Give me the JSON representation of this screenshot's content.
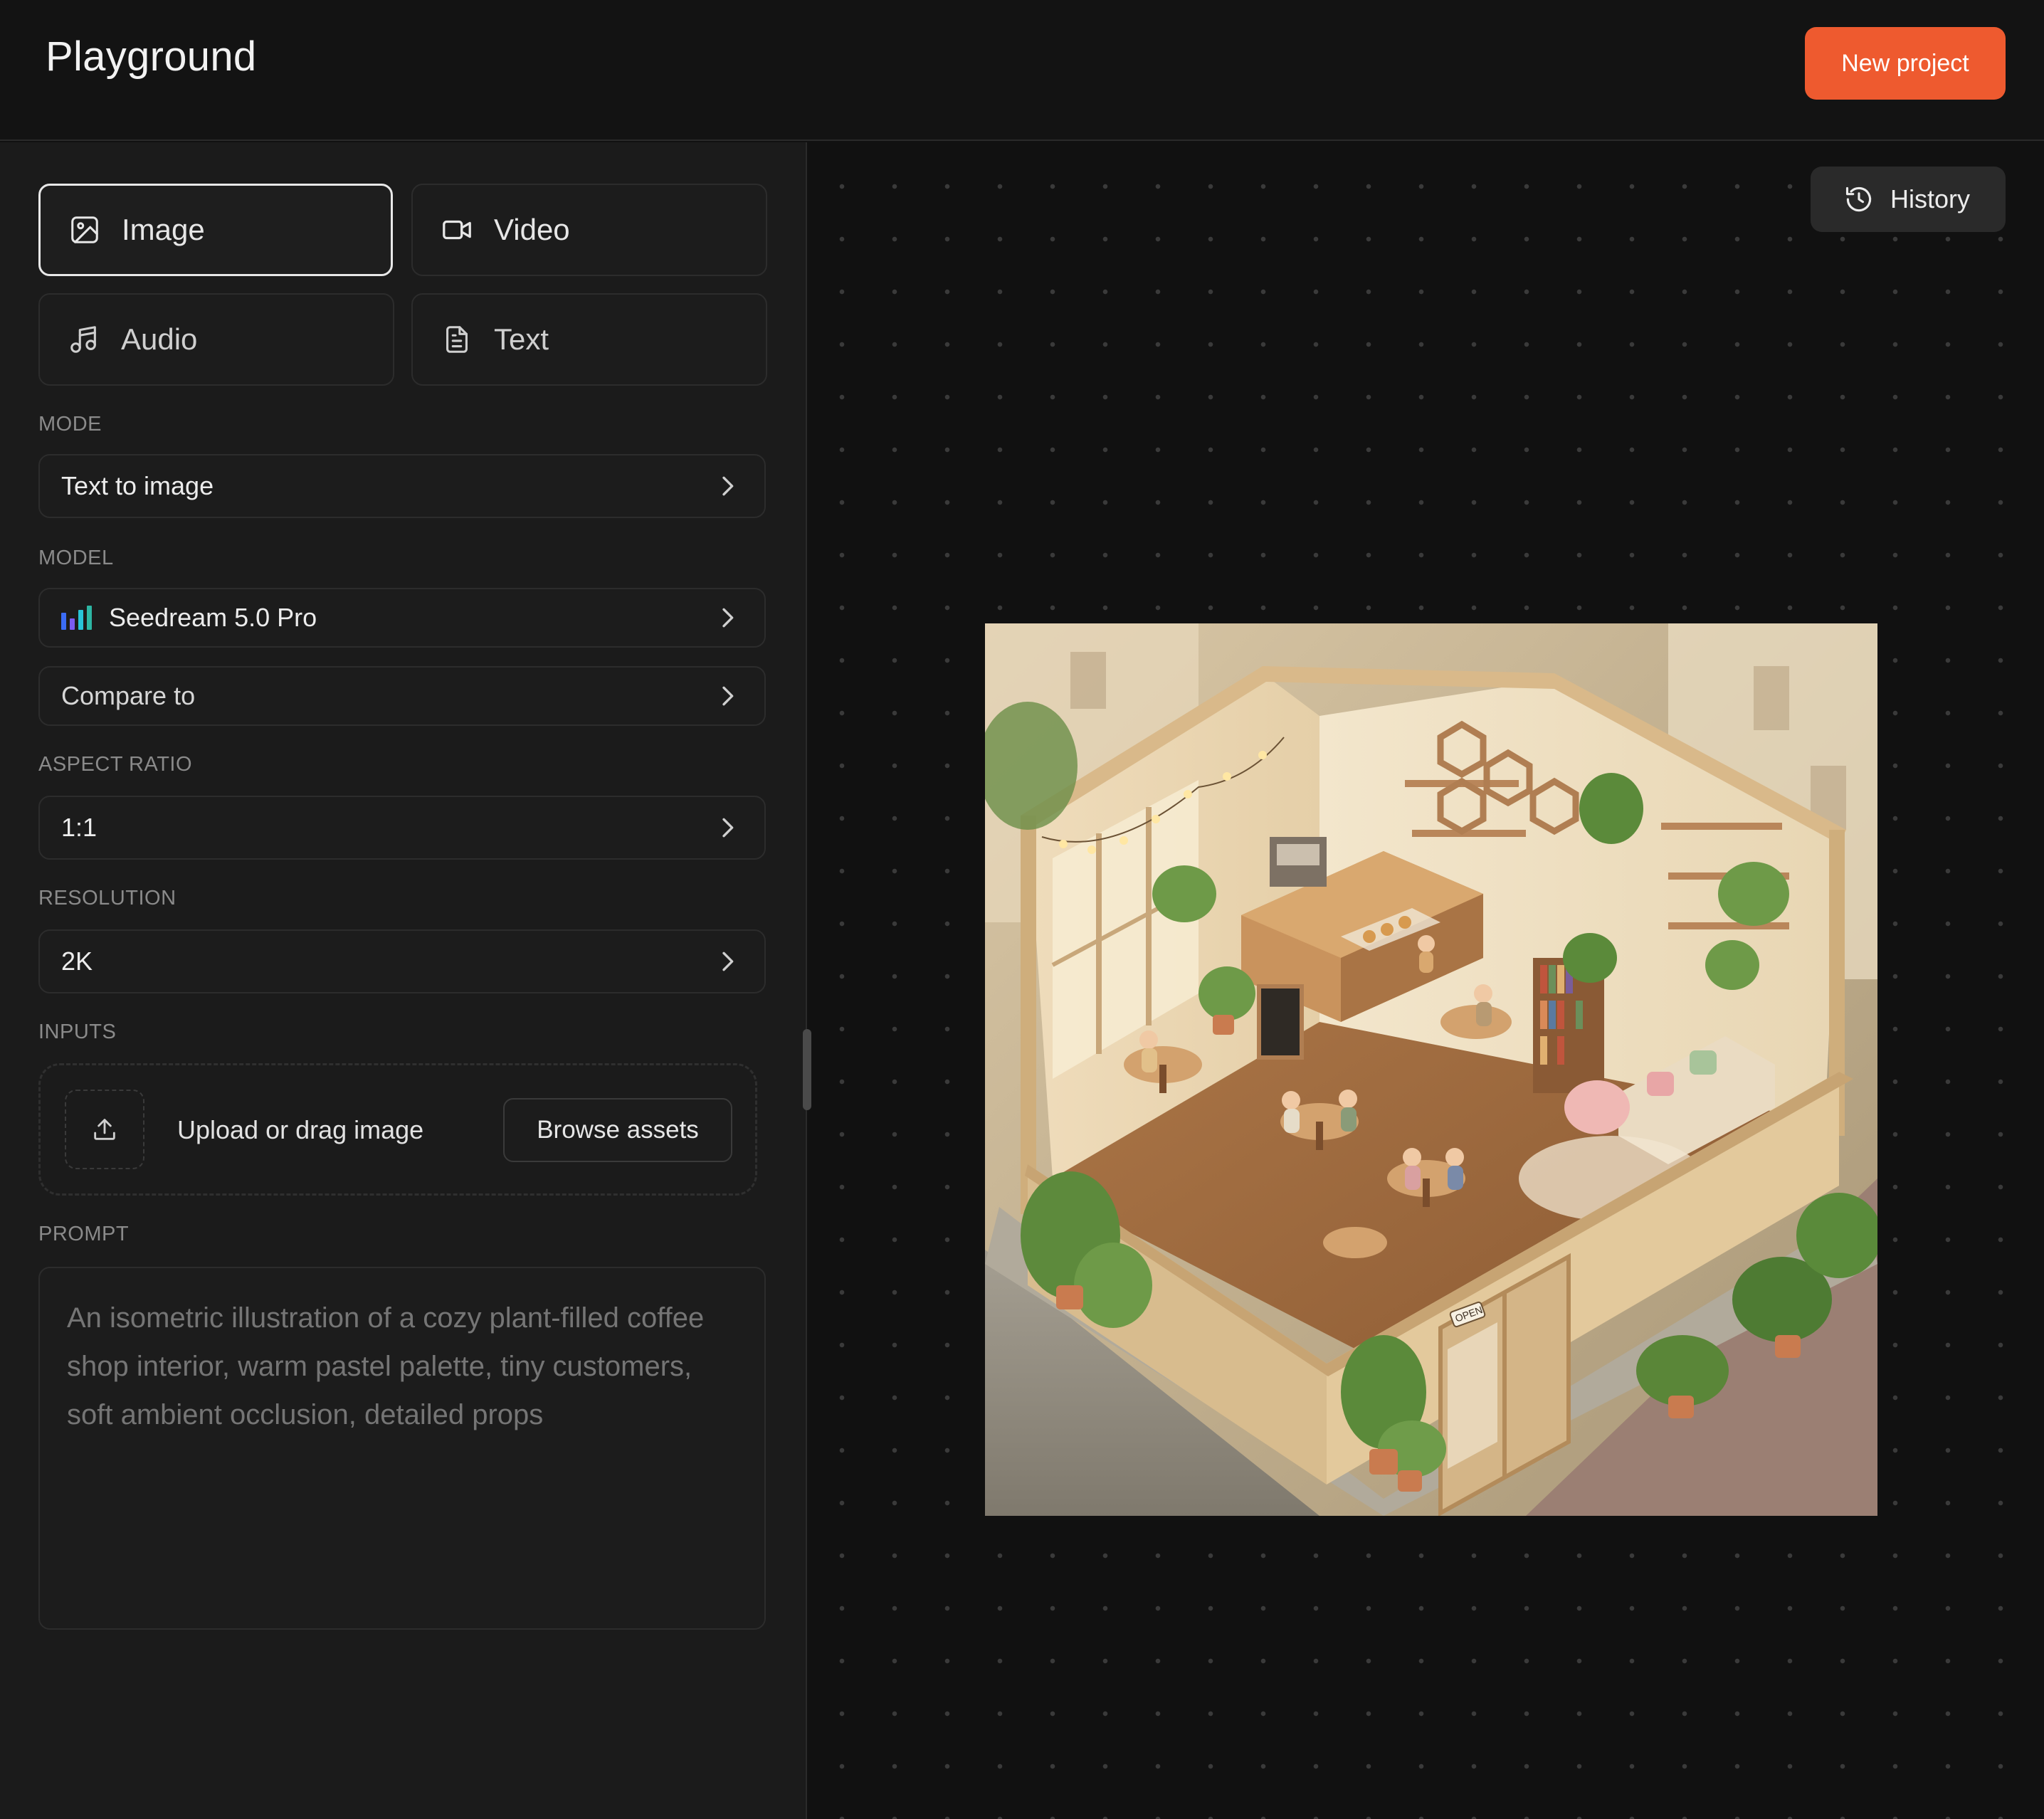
{
  "header": {
    "title": "Playground",
    "new_project_label": "New project"
  },
  "types": [
    {
      "label": "Image",
      "icon": "image-icon",
      "active": true
    },
    {
      "label": "Video",
      "icon": "video-icon",
      "active": false
    },
    {
      "label": "Audio",
      "icon": "music-icon",
      "active": false
    },
    {
      "label": "Text",
      "icon": "document-icon",
      "active": false
    }
  ],
  "mode": {
    "label": "MODE",
    "value": "Text to image"
  },
  "model": {
    "label": "MODEL",
    "value": "Seedream 5.0 Pro",
    "logo_colors": [
      "#3b6cf5",
      "#7b5cf0",
      "#29c4d8",
      "#2db6a3"
    ]
  },
  "compare": {
    "value": "Compare to"
  },
  "aspect_ratio": {
    "label": "ASPECT RATIO",
    "value": "1:1"
  },
  "resolution": {
    "label": "RESOLUTION",
    "value": "2K"
  },
  "inputs": {
    "label": "INPUTS",
    "upload_text": "Upload or drag image",
    "browse_label": "Browse assets"
  },
  "prompt": {
    "label": "PROMPT",
    "placeholder": "An isometric illustration of a cozy plant-filled coffee shop interior, warm pastel palette, tiny customers, soft ambient occlusion, detailed props"
  },
  "canvas": {
    "history_label": "History",
    "sign_text": "OPEN"
  },
  "colors": {
    "accent": "#ee5a2f",
    "background": "#111111",
    "panel": "#1b1b1b"
  }
}
